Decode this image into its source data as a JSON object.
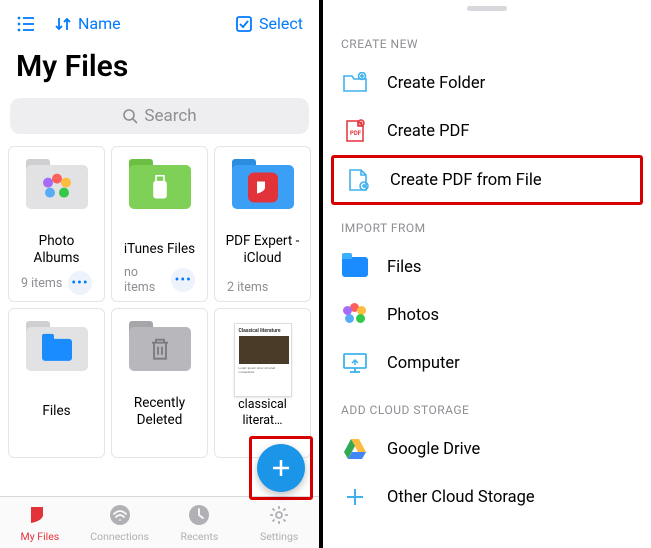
{
  "left": {
    "toolbar": {
      "sort_label": "Name",
      "select_label": "Select"
    },
    "title": "My Files",
    "search_placeholder": "Search",
    "tiles": [
      {
        "label": "Photo Albums",
        "meta": "9 items",
        "show_dots": true
      },
      {
        "label": "iTunes Files",
        "meta": "no items",
        "show_dots": true
      },
      {
        "label": "PDF Expert - iCloud",
        "meta": "2 items",
        "show_dots": false
      },
      {
        "label": "Files",
        "meta": "",
        "show_dots": false
      },
      {
        "label": "Recently Deleted",
        "meta": "",
        "show_dots": false
      },
      {
        "label": "classical literat…",
        "meta": "",
        "show_dots": false
      }
    ],
    "tabs": [
      {
        "label": "My Files"
      },
      {
        "label": "Connections"
      },
      {
        "label": "Recents"
      },
      {
        "label": "Settings"
      }
    ]
  },
  "right": {
    "sections": {
      "create": "CREATE NEW",
      "import": "IMPORT FROM",
      "cloud": "ADD CLOUD STORAGE"
    },
    "items": {
      "create_folder": "Create Folder",
      "create_pdf": "Create PDF",
      "create_pdf_file": "Create PDF from File",
      "files": "Files",
      "photos": "Photos",
      "computer": "Computer",
      "gdrive": "Google Drive",
      "other_cloud": "Other Cloud Storage"
    }
  },
  "colors": {
    "accent_blue": "#007aff",
    "accent_red": "#e2323a",
    "highlight": "#d70000"
  }
}
